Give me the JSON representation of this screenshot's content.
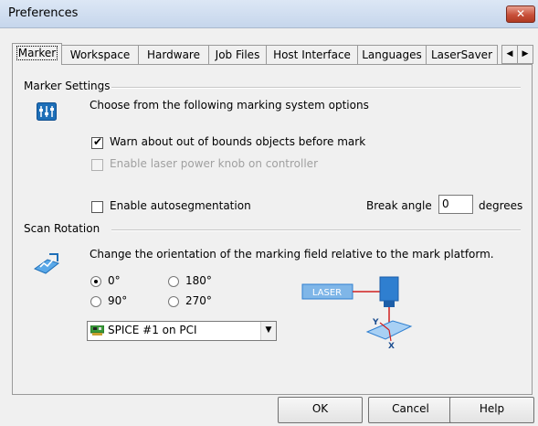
{
  "window": {
    "title": "Preferences",
    "close_glyph": "✕"
  },
  "tabs": [
    {
      "label": "Marker"
    },
    {
      "label": "Workspace"
    },
    {
      "label": "Hardware"
    },
    {
      "label": "Job Files"
    },
    {
      "label": "Host Interface"
    },
    {
      "label": "Languages"
    },
    {
      "label": "LaserSaver"
    }
  ],
  "tab_scroll": {
    "left": "◀",
    "right": "▶"
  },
  "marker_settings": {
    "header": "Marker Settings",
    "icon": "marker-settings-icon",
    "description": "Choose from the following marking system options",
    "warn_out_of_bounds": {
      "label": "Warn about out of bounds objects before mark",
      "checked": true
    },
    "laser_power_knob": {
      "label": "Enable laser power knob on controller",
      "checked": false,
      "disabled": true
    },
    "autosegmentation": {
      "label": "Enable autosegmentation",
      "checked": false
    },
    "break_angle": {
      "label": "Break angle",
      "value": "0",
      "units": "degrees"
    }
  },
  "scan_rotation": {
    "header": "Scan Rotation",
    "icon": "scan-rotation-icon",
    "description": "Change the orientation of the marking field relative to the mark platform.",
    "options": [
      {
        "label": "0°",
        "selected": true
      },
      {
        "label": "180°",
        "selected": false
      },
      {
        "label": "90°",
        "selected": false
      },
      {
        "label": "270°",
        "selected": false
      }
    ],
    "device": {
      "value": "SPICE #1 on PCI",
      "arrow": "▼"
    },
    "diagram": {
      "laser_label": "LASER",
      "y_label": "Y",
      "x_label": "X"
    }
  },
  "buttons": {
    "ok": "OK",
    "cancel": "Cancel",
    "help": "Help"
  },
  "colors": {
    "titlebar": "#c6d6ec",
    "close": "#c8503a",
    "icon_blue": "#1e6fb8",
    "diagram_blue": "#2f7fd0",
    "diagram_red": "#d02020"
  }
}
